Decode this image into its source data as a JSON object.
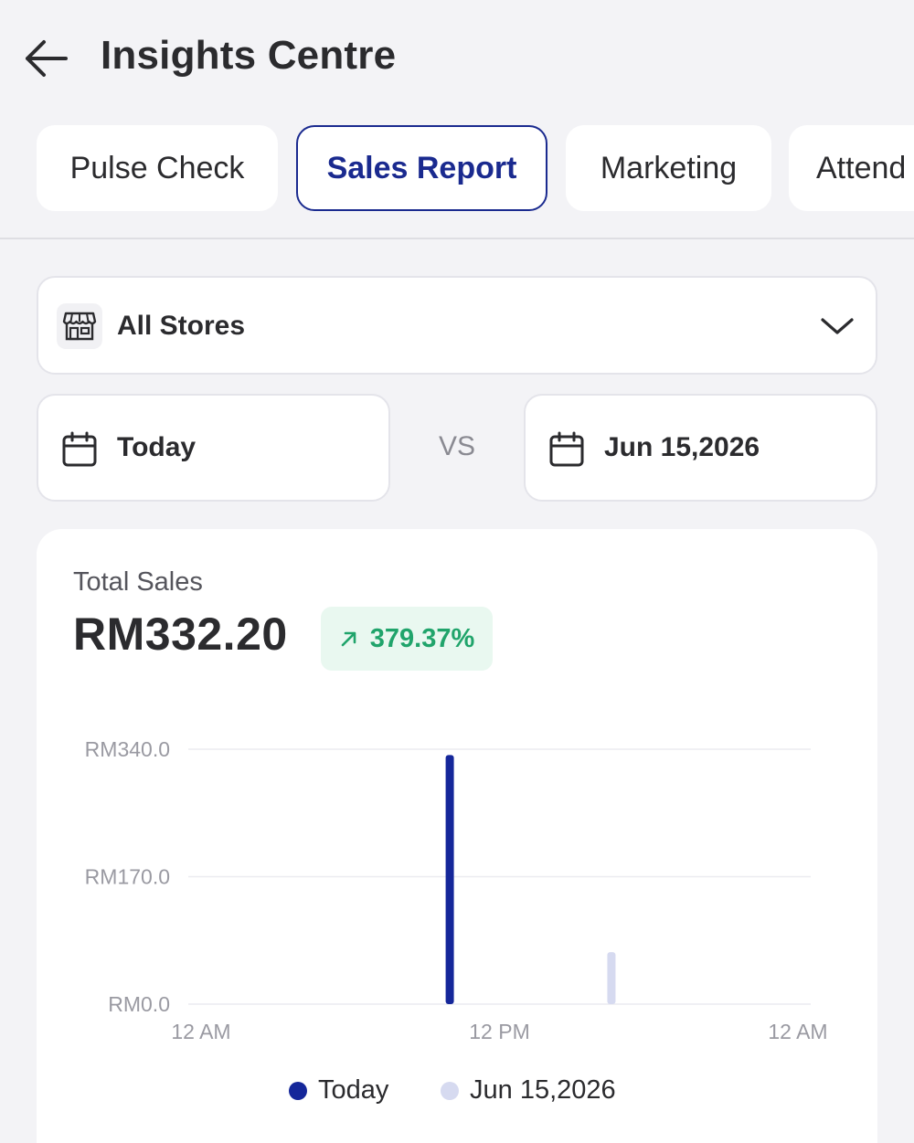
{
  "header": {
    "title": "Insights Centre",
    "back_icon": "arrow-left-icon"
  },
  "tabs": [
    {
      "label": "Pulse Check",
      "active": false
    },
    {
      "label": "Sales Report",
      "active": true
    },
    {
      "label": "Marketing",
      "active": false
    },
    {
      "label": "Attend",
      "active": false
    }
  ],
  "store_selector": {
    "label": "All Stores",
    "icon": "store-icon",
    "chevron": "chevron-down-icon"
  },
  "date_range": {
    "current": {
      "label": "Today",
      "icon": "calendar-icon"
    },
    "vs_label": "VS",
    "compare": {
      "label": "Jun 15,2026",
      "icon": "calendar-icon"
    }
  },
  "summary": {
    "label": "Total Sales",
    "value": "RM332.20",
    "change": "379.37%",
    "change_icon": "arrow-up-right-icon"
  },
  "colors": {
    "accent": "#1a2a8f",
    "series_today": "#15279a",
    "series_compare": "#d6daf0",
    "positive": "#20a46b",
    "positive_bg": "#e9f8f0"
  },
  "chart_data": {
    "type": "bar",
    "x_ticks": [
      "12 AM",
      "12 PM",
      "12 AM"
    ],
    "y_ticks": [
      "RM340.0",
      "RM170.0",
      "RM0.0"
    ],
    "ylim": [
      0,
      340
    ],
    "x_range_hours": [
      0,
      24
    ],
    "series": [
      {
        "name": "Today",
        "points": [
          {
            "hour": 10,
            "value": 332.2
          }
        ]
      },
      {
        "name": "Jun 15,2026",
        "points": [
          {
            "hour": 16.5,
            "value": 69.3
          }
        ]
      }
    ],
    "grid": true
  },
  "legend": [
    {
      "label": "Today"
    },
    {
      "label": "Jun 15,2026"
    }
  ]
}
